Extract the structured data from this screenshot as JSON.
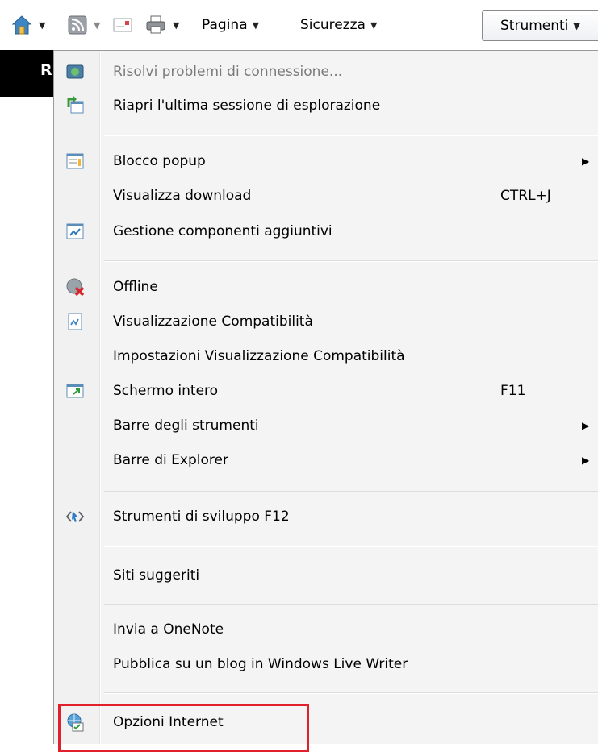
{
  "command_bar": {
    "pagina_label": "Pagina",
    "sicurezza_label": "Sicurezza",
    "strumenti_label": "Strumenti",
    "dropdown_glyph": "▼"
  },
  "page_partial_text": "R",
  "menu": {
    "risolvi": "Risolvi problemi di connessione...",
    "riapri": "Riapri l'ultima sessione di esplorazione",
    "blocco_popup": "Blocco popup",
    "visualizza_download": "Visualizza download",
    "visualizza_download_shortcut": "CTRL+J",
    "gestione_componenti": "Gestione componenti aggiuntivi",
    "offline": "Offline",
    "visualizzazione_compat": "Visualizzazione Compatibilità",
    "impostazioni_compat": "Impostazioni Visualizzazione Compatibilità",
    "schermo_intero": "Schermo intero",
    "schermo_intero_shortcut": "F11",
    "barre_strumenti": "Barre degli strumenti",
    "barre_explorer": "Barre di Explorer",
    "strumenti_sviluppo": "Strumenti di sviluppo F12",
    "siti_suggeriti": "Siti suggeriti",
    "invia_onenote": "Invia a OneNote",
    "pubblica_blog": "Pubblica su un blog in Windows Live Writer",
    "opzioni_internet": "Opzioni Internet",
    "submenu_arrow": "▶"
  },
  "colors": {
    "highlight_box": "#e0202a",
    "disabled_text": "#7a7a7a"
  }
}
